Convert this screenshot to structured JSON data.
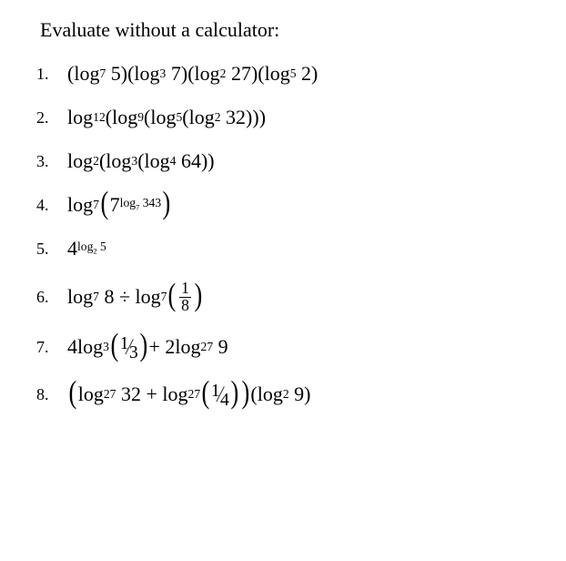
{
  "heading": "Evaluate without a calculator:",
  "items": [
    {
      "num": "1."
    },
    {
      "num": "2."
    },
    {
      "num": "3."
    },
    {
      "num": "4."
    },
    {
      "num": "5."
    },
    {
      "num": "6."
    },
    {
      "num": "7."
    },
    {
      "num": "8."
    }
  ],
  "t": {
    "log": "log",
    "lp": "(",
    "rp": ")",
    "plus": "+",
    "div": "÷",
    "dot": "·",
    "n1": "1",
    "n2": "2",
    "n3": "3",
    "n4": "4",
    "n5": "5",
    "n6": "6",
    "n7": "7",
    "n8": "8",
    "n9": "9",
    "n12": "12",
    "n27": "27",
    "n32": "32",
    "n64": "64",
    "n343": "343",
    "four_log": "4log",
    "two_log": "2log",
    "eight_div_log": "8 ÷ log",
    "thirtytwo_plus_log": "32 + log"
  }
}
